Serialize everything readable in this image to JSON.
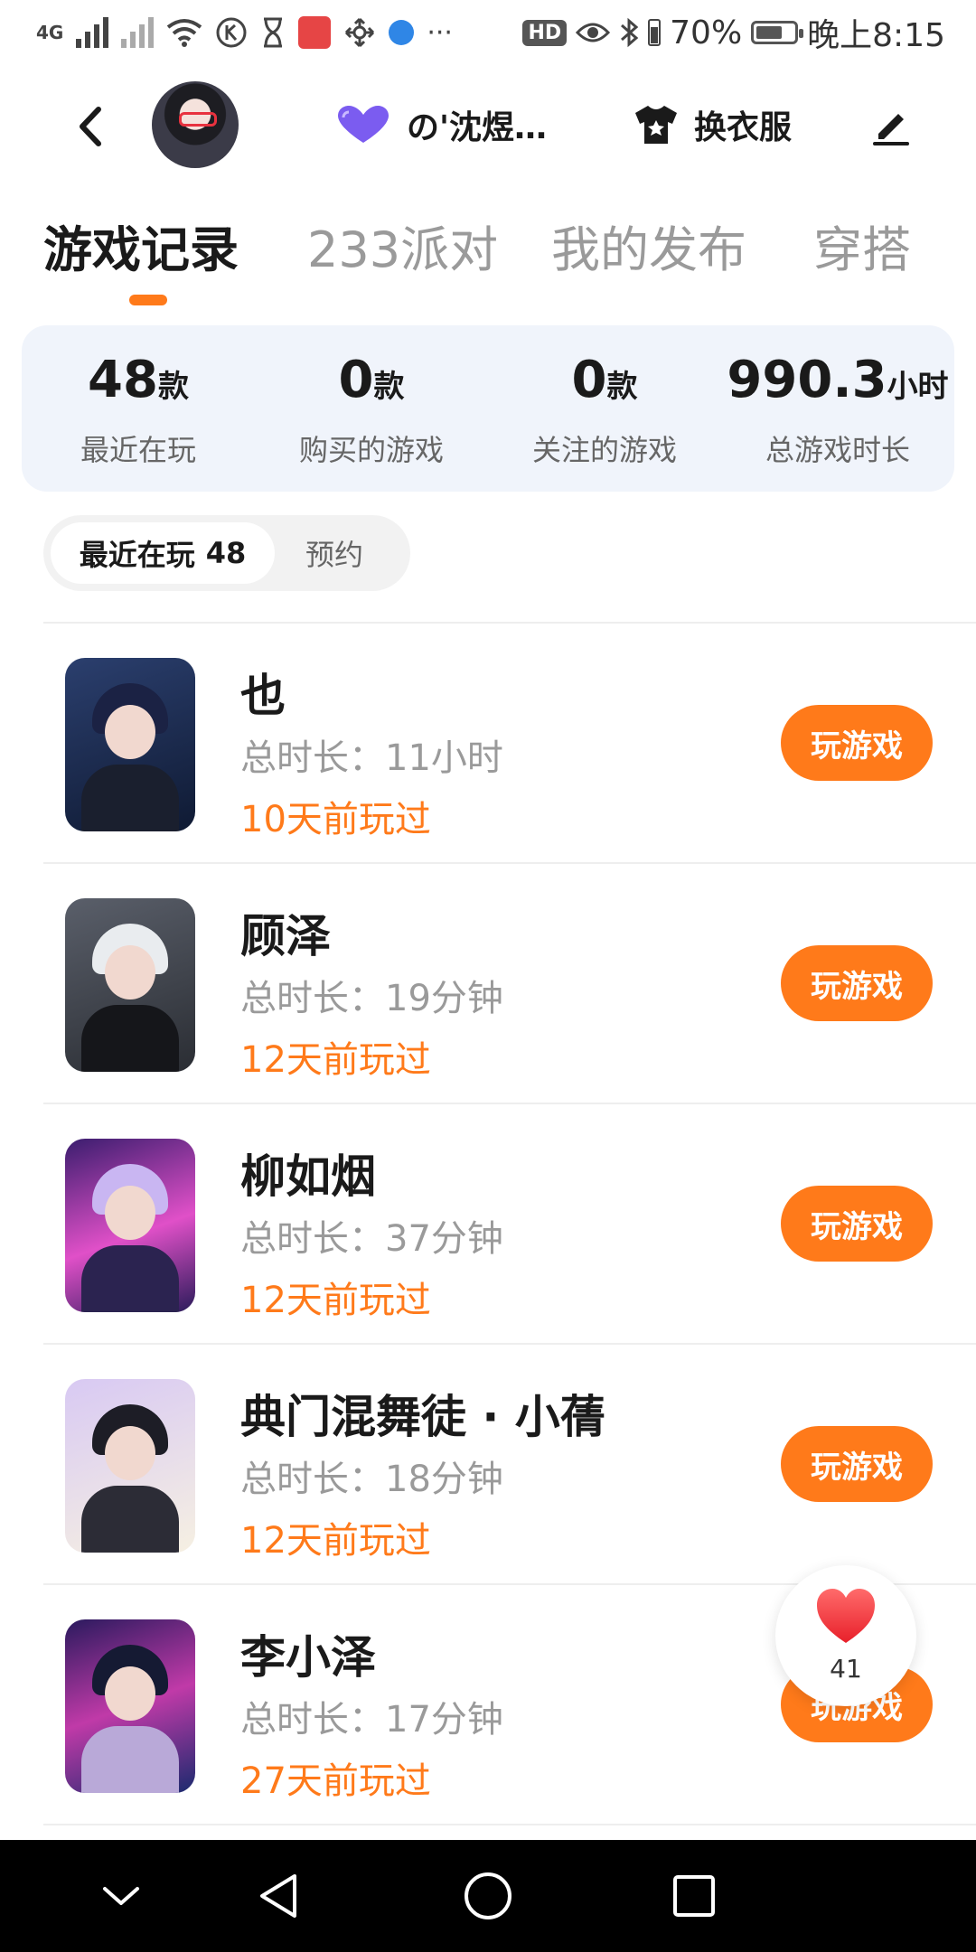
{
  "status_bar": {
    "network_label": "4G",
    "battery_percent": "70%",
    "battery_level": 0.7,
    "time": "晚上8:15",
    "hd_label": "HD"
  },
  "header": {
    "nickname": "の'沈煜…",
    "outfit_label": "换衣服",
    "icons": [
      "back-icon",
      "heart-badge-icon",
      "tshirt-icon",
      "pencil-icon"
    ]
  },
  "tabs": [
    {
      "label": "游戏记录",
      "active": true
    },
    {
      "label": "233派对",
      "active": false
    },
    {
      "label": "我的发布",
      "active": false
    },
    {
      "label": "穿搭",
      "active": false
    }
  ],
  "stats": [
    {
      "value": "48",
      "unit": "款",
      "label": "最近在玩"
    },
    {
      "value": "0",
      "unit": "款",
      "label": "购买的游戏"
    },
    {
      "value": "0",
      "unit": "款",
      "label": "关注的游戏"
    },
    {
      "value": "990.3",
      "unit": "小时",
      "label": "总游戏时长"
    }
  ],
  "filters": {
    "active_label": "最近在玩",
    "active_count": "48",
    "other_label": "预约"
  },
  "games": [
    {
      "name": "也",
      "duration": "总时长：11小时",
      "last_played": "10天前玩过",
      "button": "玩游戏"
    },
    {
      "name": "顾泽",
      "duration": "总时长：19分钟",
      "last_played": "12天前玩过",
      "button": "玩游戏"
    },
    {
      "name": "柳如烟",
      "duration": "总时长：37分钟",
      "last_played": "12天前玩过",
      "button": "玩游戏"
    },
    {
      "name": "典门混舞徒 · 小蒨",
      "duration": "总时长：18分钟",
      "last_played": "12天前玩过",
      "button": "玩游戏"
    },
    {
      "name": "李小泽",
      "duration": "总时长：17分钟",
      "last_played": "27天前玩过",
      "button": "玩游戏"
    }
  ],
  "like_fab": {
    "count": "41"
  },
  "colors": {
    "accent": "#ff7a1a",
    "stats_bg": "#f0f4fb",
    "text_primary": "#1a1a1a",
    "text_secondary": "#9a9a9a"
  }
}
